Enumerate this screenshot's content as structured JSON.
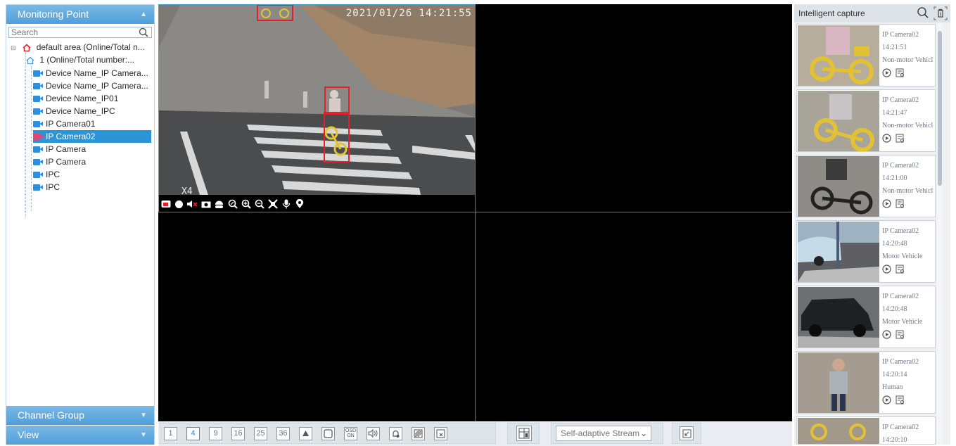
{
  "left_panel": {
    "title": "Monitoring Point",
    "search_placeholder": "Search",
    "tree": {
      "root": "default area (Online/Total n...",
      "sub": "1 (Online/Total number:...",
      "items": [
        {
          "label": "Device Name_IP Camera...",
          "selected": false
        },
        {
          "label": "Device Name_IP Camera...",
          "selected": false
        },
        {
          "label": "Device Name_IP01",
          "selected": false
        },
        {
          "label": "Device Name_IPC",
          "selected": false
        },
        {
          "label": "IP Camera01",
          "selected": false
        },
        {
          "label": "IP Camera02",
          "selected": true
        },
        {
          "label": "IP Camera",
          "selected": false
        },
        {
          "label": "IP Camera",
          "selected": false
        },
        {
          "label": "IPC",
          "selected": false
        },
        {
          "label": "IPC",
          "selected": false
        }
      ]
    },
    "channel_group": "Channel Group",
    "view": "View"
  },
  "video": {
    "osd_time": "2021/01/26 14:21:55",
    "zoom_label": "X4",
    "toolbar_icons": [
      "screenshot-icon",
      "record-icon",
      "mute-icon",
      "snapshot-icon",
      "ptz-icon",
      "zoom-icon",
      "zoom-in-icon",
      "zoom-out-icon",
      "fullscreen-icon",
      "talk-icon",
      "location-icon"
    ]
  },
  "bottom_bar": {
    "layouts": [
      "1",
      "4",
      "9",
      "16",
      "25",
      "36"
    ],
    "active_layout": "4",
    "osd_button": "OSD\nON",
    "stream_select": "Self-adaptive Stream"
  },
  "right_panel": {
    "title": "Intelligent capture",
    "captures": [
      {
        "camera": "IP Camera02",
        "time": "14:21:51",
        "type": "Non-motor Vehicl"
      },
      {
        "camera": "IP Camera02",
        "time": "14:21:47",
        "type": "Non-motor Vehicl"
      },
      {
        "camera": "IP Camera02",
        "time": "14:21:00",
        "type": "Non-motor Vehicl"
      },
      {
        "camera": "IP Camera02",
        "time": "14:20:48",
        "type": "Motor Vehicle"
      },
      {
        "camera": "IP Camera02",
        "time": "14:20:48",
        "type": "Motor Vehicle"
      },
      {
        "camera": "IP Camera02",
        "time": "14:20:14",
        "type": "Human"
      },
      {
        "camera": "IP Camera02",
        "time": "14:20:10",
        "type": ""
      }
    ]
  },
  "colors": {
    "accent": "#2c95d7",
    "detection_box": "#e0202a",
    "header_gradient": "#5aa6dc"
  }
}
